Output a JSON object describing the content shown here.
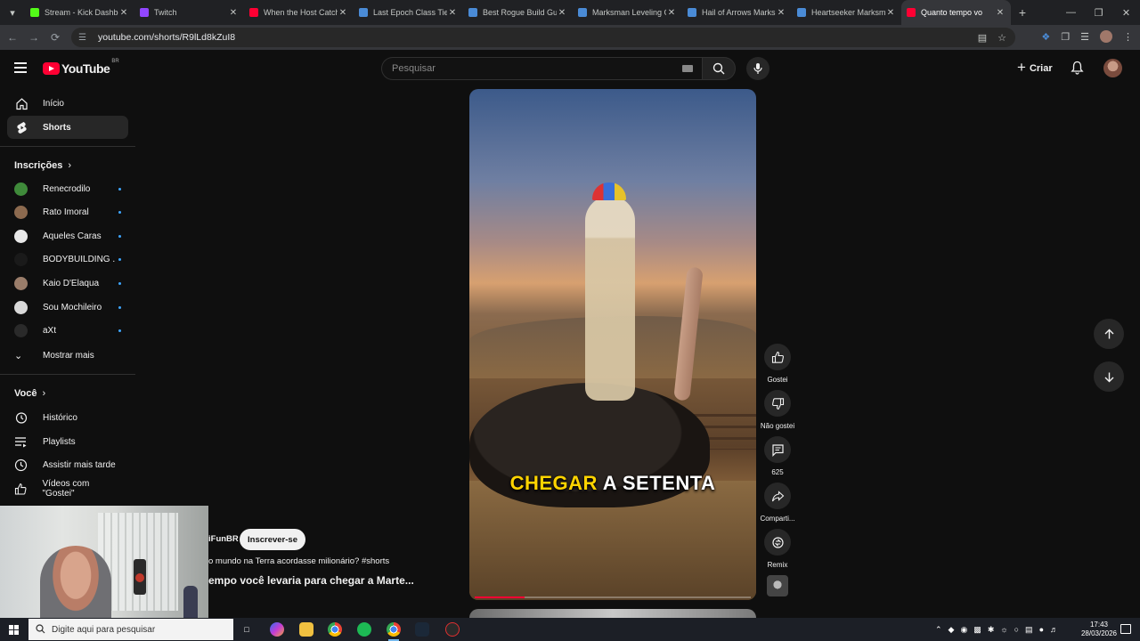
{
  "browser": {
    "tabs": [
      {
        "label": "Stream - Kick Dashbo",
        "icon": "kick-icon",
        "color": "#53fc18"
      },
      {
        "label": "Twitch",
        "icon": "twitch-icon",
        "color": "#9146ff"
      },
      {
        "label": "When the Host Catch",
        "icon": "youtube-icon",
        "color": "#ff0033"
      },
      {
        "label": "Last Epoch Class Tier",
        "icon": "maxroll-icon",
        "color": "#4a8bd6"
      },
      {
        "label": "Best Rogue Build Gu",
        "icon": "maxroll-icon",
        "color": "#4a8bd6"
      },
      {
        "label": "Marksman Leveling G",
        "icon": "maxroll-icon",
        "color": "#4a8bd6"
      },
      {
        "label": "Hail of Arrows Marks",
        "icon": "maxroll-icon",
        "color": "#4a8bd6"
      },
      {
        "label": "Heartseeker Marksma",
        "icon": "maxroll-icon",
        "color": "#4a8bd6"
      },
      {
        "label": "Quanto tempo vo",
        "icon": "youtube-icon",
        "color": "#ff0033",
        "active": true
      }
    ],
    "url": "youtube.com/shorts/R9lLd8kZuI8"
  },
  "youtube": {
    "logo_text": "YouTube",
    "country_code": "BR",
    "search_placeholder": "Pesquisar",
    "create_label": "Criar"
  },
  "sidebar": {
    "main": [
      {
        "label": "Início",
        "icon": "home-icon"
      },
      {
        "label": "Shorts",
        "icon": "shorts-icon",
        "active": true
      }
    ],
    "subscriptions_header": "Inscrições",
    "subscriptions": [
      {
        "label": "Renecrodilo",
        "color": "#3f8a3a"
      },
      {
        "label": "Rato Imoral",
        "color": "#8c6a4f"
      },
      {
        "label": "Aqueles Caras",
        "color": "#e8e8e8"
      },
      {
        "label": "BODYBUILDING ...",
        "color": "#1a1a1a"
      },
      {
        "label": "Kaio D'Elaqua",
        "color": "#9a7d6a"
      },
      {
        "label": "Sou Mochileiro",
        "color": "#d9d9d9"
      },
      {
        "label": "aXt",
        "color": "#2a2a2a"
      }
    ],
    "show_more": "Mostrar mais",
    "you_header": "Você",
    "you_items": [
      {
        "label": "Histórico",
        "icon": "history-icon"
      },
      {
        "label": "Playlists",
        "icon": "playlists-icon"
      },
      {
        "label": "Assistir mais tarde",
        "icon": "watch-later-icon"
      },
      {
        "label": "Vídeos com \"Gostei\"",
        "icon": "liked-videos-icon"
      }
    ]
  },
  "short": {
    "channel": "iFunBR",
    "subscribe_label": "Inscrever-se",
    "description": "o mundo na Terra acordasse milionário? #shorts",
    "title": "empo você levaria para chegar a Marte...",
    "caption_highlight": "CHEGAR",
    "caption_rest": "A SETENTA",
    "progress": 0.18
  },
  "actions": {
    "like": "Gostei",
    "dislike": "Não gostei",
    "comments": "625",
    "share": "Comparti...",
    "remix": "Remix"
  },
  "taskbar": {
    "search_placeholder": "Digite aqui para pesquisar",
    "time": "17:43",
    "date": "28/03/2026"
  }
}
